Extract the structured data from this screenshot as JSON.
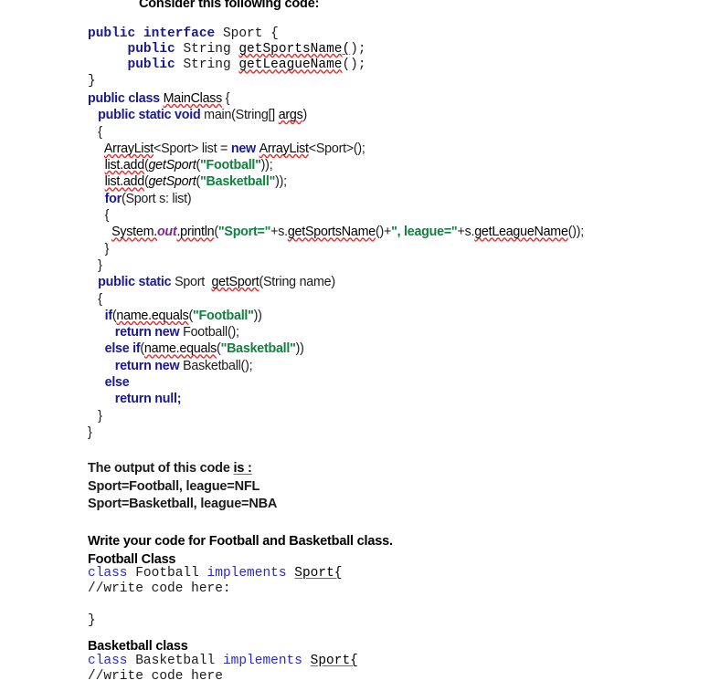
{
  "document": {
    "heading": "Consider this following code:",
    "interface_code": {
      "lines": [
        [
          {
            "t": "public interface ",
            "s": "kw"
          },
          {
            "t": "Sport {",
            "s": "pl"
          }
        ],
        [
          {
            "t": "     ",
            "s": "pl"
          },
          {
            "t": "public ",
            "s": "kw"
          },
          {
            "t": "String ",
            "s": "pl"
          },
          {
            "t": "getSportsName",
            "s": "sq"
          },
          {
            "t": "(",
            "s": "gu-mono"
          },
          {
            "t": ");",
            "s": "pl"
          }
        ],
        [
          {
            "t": "     ",
            "s": "pl"
          },
          {
            "t": "public ",
            "s": "kw"
          },
          {
            "t": "String ",
            "s": "pl"
          },
          {
            "t": "getLeagueName",
            "s": "sq"
          },
          {
            "t": "();",
            "s": "pl"
          }
        ],
        [
          {
            "t": "}",
            "s": "pl"
          }
        ]
      ]
    },
    "main_code": {
      "lines": [
        [
          {
            "t": "public class ",
            "s": "kw"
          },
          {
            "t": "MainClass",
            "s": "sq"
          },
          {
            "t": " {",
            "s": "pl"
          }
        ],
        [
          {
            "t": "   ",
            "s": "pl"
          },
          {
            "t": "public static void ",
            "s": "kw"
          },
          {
            "t": "main(String[] ",
            "s": "pl"
          },
          {
            "t": "args",
            "s": "sq"
          },
          {
            "t": ")",
            "s": "pl"
          }
        ],
        [
          {
            "t": "   {",
            "s": "pl"
          }
        ],
        [
          {
            "t": "     ",
            "s": "pl"
          },
          {
            "t": "ArrayList",
            "s": "sq"
          },
          {
            "t": "<Sport> list = ",
            "s": "pl"
          },
          {
            "t": "new ",
            "s": "kw"
          },
          {
            "t": "ArrayList",
            "s": "sq"
          },
          {
            "t": "<Sport>();",
            "s": "pl"
          }
        ],
        [
          {
            "t": "     ",
            "s": "pl"
          },
          {
            "t": "list.add",
            "s": "sq"
          },
          {
            "t": "(",
            "s": "pl"
          },
          {
            "t": "getSport",
            "s": "ital"
          },
          {
            "t": "(",
            "s": "pl"
          },
          {
            "t": "\"Football\"",
            "s": "str"
          },
          {
            "t": "));",
            "s": "pl"
          }
        ],
        [
          {
            "t": "     ",
            "s": "pl"
          },
          {
            "t": "list.add",
            "s": "sq"
          },
          {
            "t": "(",
            "s": "pl"
          },
          {
            "t": "getSport",
            "s": "ital"
          },
          {
            "t": "(",
            "s": "pl"
          },
          {
            "t": "\"Basketball\"",
            "s": "str"
          },
          {
            "t": "));",
            "s": "pl"
          }
        ],
        [
          {
            "t": "     ",
            "s": "pl"
          },
          {
            "t": "for",
            "s": "kw"
          },
          {
            "t": "(Sport s: list)",
            "s": "pl"
          }
        ],
        [
          {
            "t": "     {",
            "s": "pl"
          }
        ],
        [
          {
            "t": "       ",
            "s": "pl"
          },
          {
            "t": "System.",
            "s": "sq"
          },
          {
            "t": "out",
            "s": "fld"
          },
          {
            "t": ".println",
            "s": "sq"
          },
          {
            "t": "(",
            "s": "pl"
          },
          {
            "t": "\"Sport=\"",
            "s": "str"
          },
          {
            "t": "+s.",
            "s": "pl"
          },
          {
            "t": "getSportsName",
            "s": "sq"
          },
          {
            "t": "()+",
            "s": "pl"
          },
          {
            "t": "\", league=\"",
            "s": "str"
          },
          {
            "t": "+s.",
            "s": "pl"
          },
          {
            "t": "getLeagueName",
            "s": "sq"
          },
          {
            "t": "());",
            "s": "pl"
          }
        ],
        [
          {
            "t": "     }",
            "s": "pl"
          }
        ],
        [
          {
            "t": "   }",
            "s": "pl"
          }
        ],
        [
          {
            "t": "   ",
            "s": "pl"
          },
          {
            "t": "public static ",
            "s": "kw"
          },
          {
            "t": "Sport  ",
            "s": "pl"
          },
          {
            "t": "getSport",
            "s": "sq"
          },
          {
            "t": "(String name)",
            "s": "pl"
          }
        ],
        [
          {
            "t": "   {",
            "s": "pl"
          }
        ],
        [
          {
            "t": "     ",
            "s": "pl"
          },
          {
            "t": "if",
            "s": "kw"
          },
          {
            "t": "(",
            "s": "pl"
          },
          {
            "t": "name.equals",
            "s": "sq"
          },
          {
            "t": "(",
            "s": "pl"
          },
          {
            "t": "\"Football\"",
            "s": "str"
          },
          {
            "t": "))",
            "s": "pl"
          }
        ],
        [
          {
            "t": "        ",
            "s": "pl"
          },
          {
            "t": "return new ",
            "s": "kw"
          },
          {
            "t": "Football();",
            "s": "pl"
          }
        ],
        [
          {
            "t": "     ",
            "s": "pl"
          },
          {
            "t": "else if",
            "s": "kw"
          },
          {
            "t": "(",
            "s": "pl"
          },
          {
            "t": "name.equals",
            "s": "sq"
          },
          {
            "t": "(",
            "s": "pl"
          },
          {
            "t": "\"Basketball\"",
            "s": "str"
          },
          {
            "t": "))",
            "s": "pl"
          }
        ],
        [
          {
            "t": "        ",
            "s": "pl"
          },
          {
            "t": "return new ",
            "s": "kw"
          },
          {
            "t": "Basketball();",
            "s": "pl"
          }
        ],
        [
          {
            "t": "     ",
            "s": "pl"
          },
          {
            "t": "else",
            "s": "kw"
          }
        ],
        [
          {
            "t": "        ",
            "s": "pl"
          },
          {
            "t": "return null;",
            "s": "kw"
          }
        ],
        [
          {
            "t": "   }",
            "s": "pl"
          }
        ],
        [
          {
            "t": "}",
            "s": "pl"
          }
        ]
      ]
    },
    "output_section": {
      "lines": [
        [
          {
            "t": "The output of this code ",
            "s": "pl"
          },
          {
            "t": "is :",
            "s": "gu"
          }
        ],
        [
          {
            "t": "Sport=Football, league=NFL",
            "s": "pl"
          }
        ],
        [
          {
            "t": "Sport=Basketball, league=NBA",
            "s": "pl"
          }
        ]
      ]
    },
    "write_instruction": "Write your code for Football and Basketball class.",
    "football_title": "Football Class",
    "football_code": {
      "lines": [
        [
          {
            "t": "class ",
            "s": "blue-kw"
          },
          {
            "t": "Football ",
            "s": "pl"
          },
          {
            "t": "implements ",
            "s": "blue-kw"
          },
          {
            "t": "Sport{",
            "s": "gu-mono"
          }
        ],
        [
          {
            "t": "//write code here:",
            "s": "pl"
          }
        ],
        [
          {
            "t": "",
            "s": "pl"
          }
        ],
        [
          {
            "t": "}",
            "s": "pl"
          }
        ]
      ]
    },
    "basketball_title": "Basketball class",
    "basketball_code": {
      "lines": [
        [
          {
            "t": "class ",
            "s": "blue-kw"
          },
          {
            "t": "Basketball ",
            "s": "pl"
          },
          {
            "t": "implements ",
            "s": "blue-kw"
          },
          {
            "t": "Sport{",
            "s": "gu-mono"
          }
        ],
        [
          {
            "t": "//write code here",
            "s": "pl"
          }
        ]
      ]
    },
    "colors": {
      "keyword": "#1a1a8c",
      "string": "#128040",
      "field": "#7b2d8e",
      "spellcheck_squiggle": "#e03030",
      "grammar_underline": "#3a6fd8",
      "mono_keyword": "#2b2bbf",
      "text": "#000000",
      "background": "#ffffff"
    }
  }
}
